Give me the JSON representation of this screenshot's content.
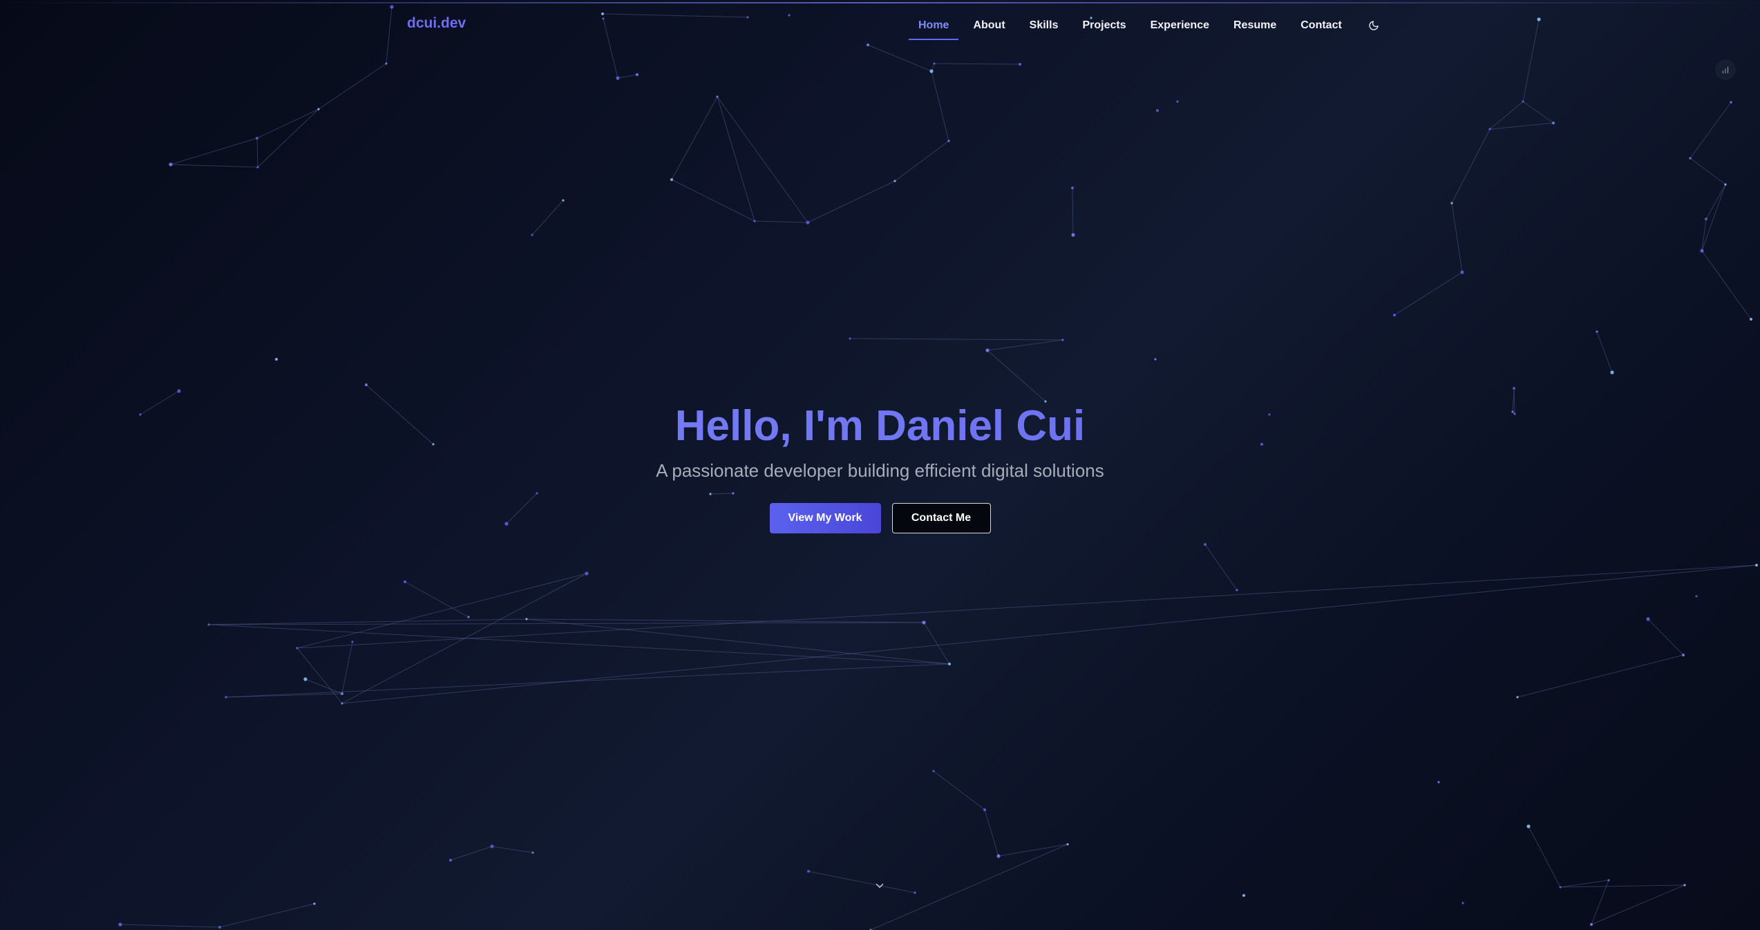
{
  "site": {
    "logo": "dcui.dev"
  },
  "nav": {
    "items": [
      {
        "label": "Home",
        "active": true
      },
      {
        "label": "About",
        "active": false
      },
      {
        "label": "Skills",
        "active": false
      },
      {
        "label": "Projects",
        "active": false
      },
      {
        "label": "Experience",
        "active": false
      },
      {
        "label": "Resume",
        "active": false
      },
      {
        "label": "Contact",
        "active": false
      }
    ],
    "theme_toggle_icon": "moon-icon"
  },
  "hero": {
    "title": "Hello, I'm Daniel Cui",
    "subtitle": "A passionate developer building efficient digital solutions",
    "primary_button": "View My Work",
    "secondary_button": "Contact Me"
  },
  "icons": {
    "stats": "bar-chart-icon",
    "scroll": "chevron-down-icon"
  },
  "colors": {
    "accent": "#6366f1",
    "accent_light": "#818cf8",
    "background": "#0d1328",
    "text": "#f1f3f8",
    "muted_text": "#a5adbb"
  }
}
